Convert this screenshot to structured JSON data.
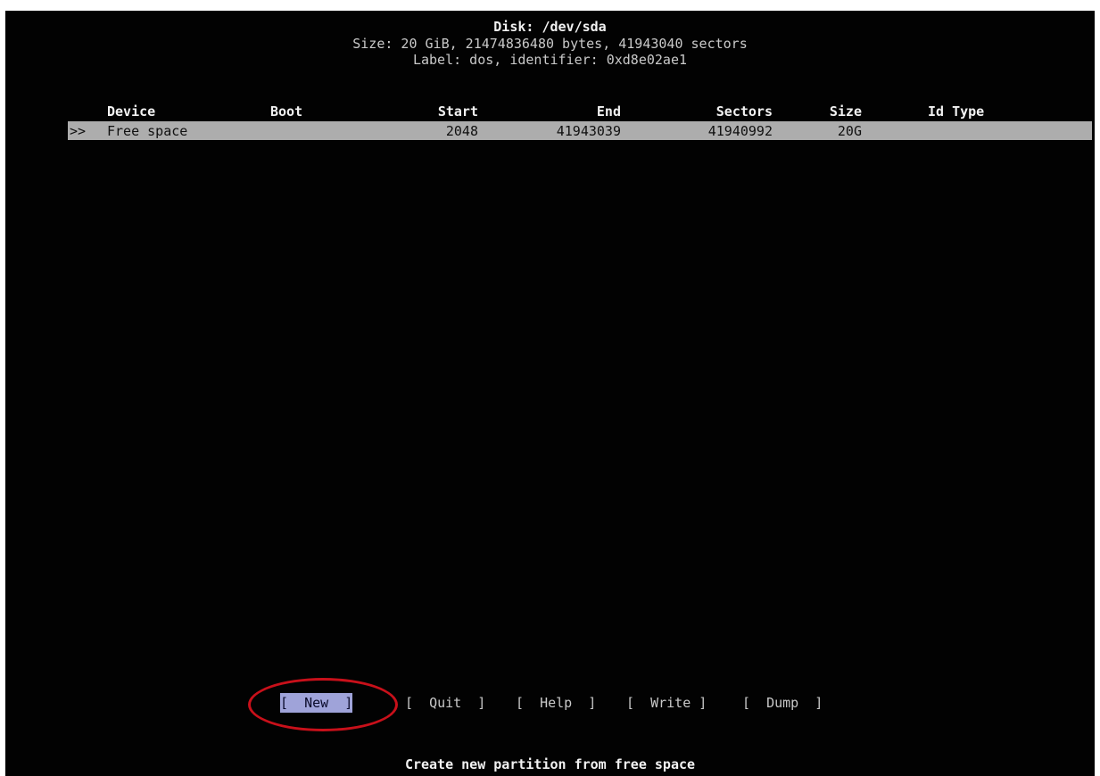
{
  "header": {
    "disk": "Disk: /dev/sda",
    "size": "Size: 20 GiB, 21474836480 bytes, 41943040 sectors",
    "label": "Label: dos, identifier: 0xd8e02ae1"
  },
  "table": {
    "columns": [
      "Device",
      "Boot",
      "Start",
      "End",
      "Sectors",
      "Size",
      "Id Type"
    ],
    "selection_marker": ">>",
    "rows": [
      {
        "device": "Free space",
        "boot": "",
        "start": "2048",
        "end": "41943039",
        "sectors": "41940992",
        "size": "20G",
        "id_type": ""
      }
    ]
  },
  "menu": {
    "new": "[  New  ]",
    "quit": "[  Quit  ]",
    "help": "[  Help  ]",
    "write": "[  Write ]",
    "dump": "[  Dump  ]"
  },
  "status": "Create new partition from free space",
  "colors": {
    "background": "#020202",
    "selected_row": "#adadad",
    "selected_button": "#9fa3d9",
    "annotation_circle": "#c8101a"
  }
}
